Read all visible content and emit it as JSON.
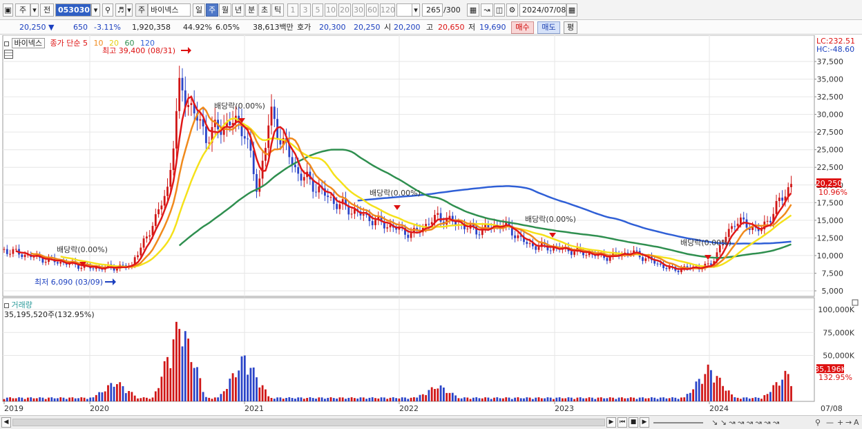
{
  "toolbar": {
    "period_type": "주",
    "prev_label": "전",
    "code": "053030",
    "stock_name": "바이넥스",
    "stock_badge": "주",
    "periods": [
      "일",
      "주",
      "월",
      "년",
      "분",
      "초",
      "틱"
    ],
    "active_period": "주",
    "intervals": [
      "1",
      "3",
      "5",
      "10",
      "20",
      "30",
      "60",
      "120"
    ],
    "count": "265",
    "count_total": "/300",
    "date": "2024/07/08"
  },
  "quote": {
    "price": "20,250",
    "change": "650",
    "change_rate": "-3.11%",
    "volume": "1,920,358",
    "vol_ratio": "44.92%",
    "turnover_rate": "6.05%",
    "amount": "38,613백만",
    "ask_label": "호가",
    "ask1": "20,300",
    "ask2": "20,250",
    "open_label": "시",
    "open": "20,200",
    "high_label": "고",
    "high": "20,650",
    "low_label": "저",
    "low": "19,690",
    "buy_label": "매수",
    "sell_label": "매도",
    "avg_label": "평"
  },
  "legend": {
    "name": "바이넥스",
    "ma_title": "종가 단순",
    "ma_periods": [
      "5",
      "10",
      "20",
      "60",
      "120"
    ],
    "volume_title": "거래량",
    "volume_value": "35,195,520주(132.95%)"
  },
  "axis": {
    "lc": "LC:232.51",
    "hc": "HC:-48.60",
    "price_ticks": [
      "37,500",
      "35,000",
      "32,500",
      "30,000",
      "27,500",
      "25,000",
      "22,500",
      "20,000",
      "17,500",
      "15,000",
      "12,500",
      "10,000",
      "7,500",
      "5,000"
    ],
    "volume_ticks": [
      "100,000K",
      "75,000K",
      "50,000K"
    ],
    "x_labels": [
      "2019",
      "2020",
      "2021",
      "2022",
      "2023",
      "2024",
      "07/08"
    ],
    "current_price_badge": "20,250",
    "current_change_badge": "10.96%",
    "current_volume_badge": "35,196K",
    "current_volume_rate": "132.95%"
  },
  "annotations": {
    "high_note": "최고 39,400 (08/31)",
    "low_note": "최저 6,090 (03/09)",
    "dividend": "배당락(0.00%)"
  },
  "colors": {
    "up": "#d01616",
    "down": "#2a44c8",
    "ma5": "#e01818",
    "ma10": "#f08a1c",
    "ma20": "#f5e11a",
    "ma60": "#2f8f4f",
    "ma120": "#2f5fd6"
  },
  "chart_data": {
    "type": "candlestick",
    "x": [
      "2019",
      "2020",
      "2021",
      "2022",
      "2023",
      "2024",
      "07/08"
    ],
    "price_range": [
      5000,
      39400
    ],
    "price": [
      {
        "date": "2019-01",
        "value": 10800
      },
      {
        "date": "2019-04",
        "value": 9500
      },
      {
        "date": "2019-08",
        "value": 8200
      },
      {
        "date": "2019-11",
        "value": 8500
      },
      {
        "date": "2020-03",
        "value": 7000
      },
      {
        "date": "2020-05",
        "value": 11000
      },
      {
        "date": "2020-07",
        "value": 19000
      },
      {
        "date": "2020-08",
        "value": 34000
      },
      {
        "date": "2020-10",
        "value": 27000
      },
      {
        "date": "2020-12",
        "value": 29000
      },
      {
        "date": "2021-01",
        "value": 28000
      },
      {
        "date": "2021-02",
        "value": 19000
      },
      {
        "date": "2021-03",
        "value": 30000
      },
      {
        "date": "2021-05",
        "value": 22000
      },
      {
        "date": "2021-08",
        "value": 17500
      },
      {
        "date": "2021-11",
        "value": 15000
      },
      {
        "date": "2022-02",
        "value": 13000
      },
      {
        "date": "2022-04",
        "value": 15500
      },
      {
        "date": "2022-07",
        "value": 13500
      },
      {
        "date": "2022-09",
        "value": 14500
      },
      {
        "date": "2022-11",
        "value": 11500
      },
      {
        "date": "2023-02",
        "value": 10800
      },
      {
        "date": "2023-05",
        "value": 9800
      },
      {
        "date": "2023-07",
        "value": 10500
      },
      {
        "date": "2023-10",
        "value": 8000
      },
      {
        "date": "2024-01",
        "value": 8500
      },
      {
        "date": "2024-03",
        "value": 15000
      },
      {
        "date": "2024-05",
        "value": 13500
      },
      {
        "date": "2024-07",
        "value": 20250
      }
    ],
    "volume": [
      {
        "date": "2020-03",
        "value": 25000
      },
      {
        "date": "2020-08",
        "value": 100000
      },
      {
        "date": "2021-01",
        "value": 55000
      },
      {
        "date": "2022-04",
        "value": 20000
      },
      {
        "date": "2024-01",
        "value": 42000
      },
      {
        "date": "2024-07",
        "value": 35196
      }
    ]
  }
}
